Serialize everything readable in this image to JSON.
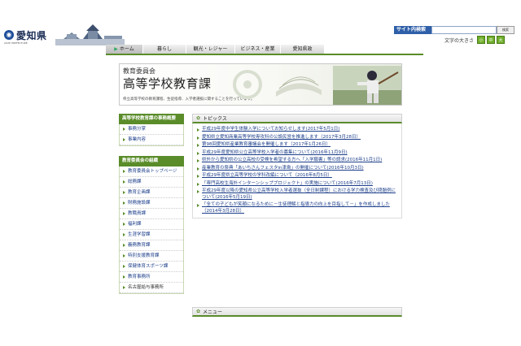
{
  "header": {
    "logo_text": "愛知県",
    "logo_sub": "AICHI PREFECTURE",
    "search_label": "サイト内検索",
    "search_button": "検索",
    "font_size_label": "文字の大きさ",
    "font_size_buttons": [
      "小",
      "中",
      "大"
    ]
  },
  "nav": {
    "items": [
      "ホーム",
      "暮らし",
      "観光・レジャー",
      "ビジネス・産業",
      "愛知県政"
    ]
  },
  "banner": {
    "subtitle": "教育委員会",
    "title": "高等学校教育課",
    "description": "県立高等学校の教育課程、生徒指導、入学者選抜に関することを行っています。"
  },
  "sidebar": {
    "section1_title": "高等学校教育課の事務概要",
    "section1_items": [
      "事務分掌",
      "事業内容"
    ],
    "section2_title": "教育委員会の組織",
    "section2_items": [
      "教育委員会トップページ",
      "総務課",
      "教育企画課",
      "財務施設課",
      "教職員課",
      "福利課",
      "生涯学習課",
      "義務教育課",
      "特別支援教育課",
      "保健体育スポーツ課",
      "教育事務所",
      "名古屋給与事務所"
    ]
  },
  "topics": {
    "title": "トピックス",
    "items": [
      "平成29年度中学生体験入学についてお知らせします(2017年5月1日)",
      "愛知県立愛知商業高等学校専攻科の公設民営を推進します（2017年3月28日）",
      "第98回愛知県産業教育審議会を開催します（2017年1月26日）",
      "平成29年度愛知県公立高等学校入学者の募集について(2016年11月9日)",
      "県外から愛知県の公立高校の受検を希望する方へ「入学願書」等の請求(2016年11月1日)",
      "産業教育の祭典「あいちさんフェスタin津島」の開催について(2016年10月3日)",
      "平成29年度県立高等学校の学科改編について（2016年8月5日）",
      "「専門高校生海外インターンシッププロジェクト」の実施について(2016年7月13日)",
      "平成29年度以降の愛知県公立高等学校入学者選抜（全日制課程）における学力検査及び問題例について(2016年5月19日)",
      "「全ての子どもが笑顔になるために－生徒理解と指導力の向上を目指して－」を作成しました（2014年3月28日）"
    ]
  },
  "menu": {
    "title": "メニュー"
  },
  "colors": {
    "accent_green": "#5a8c2a",
    "link_blue": "#1d3f8a",
    "search_blue": "#2f5fa8"
  }
}
